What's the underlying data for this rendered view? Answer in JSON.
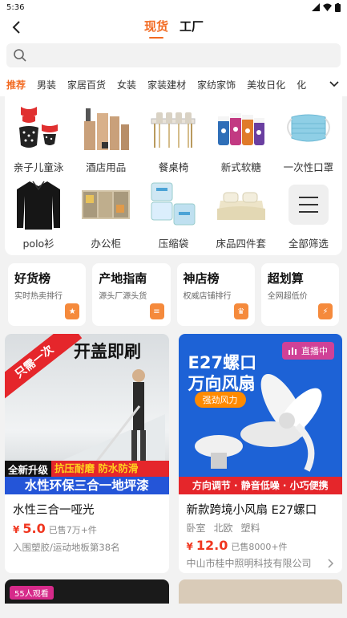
{
  "status": {
    "time": "5:36"
  },
  "nav": {
    "tabs": [
      {
        "label": "现货",
        "active": true
      },
      {
        "label": "工厂",
        "active": false
      }
    ]
  },
  "search": {
    "placeholder": ""
  },
  "categories": {
    "items": [
      "推荐",
      "男装",
      "家居百货",
      "女装",
      "家装建材",
      "家纺家饰",
      "美妆日化",
      "化"
    ],
    "active_index": 0
  },
  "grid": {
    "items": [
      {
        "label": "亲子儿童泳",
        "icon": "swimsuit-image"
      },
      {
        "label": "酒店用品",
        "icon": "hotel-supplies-image"
      },
      {
        "label": "餐桌椅",
        "icon": "dining-chairs-image"
      },
      {
        "label": "新式软糖",
        "icon": "gummy-jars-image"
      },
      {
        "label": "一次性口罩",
        "icon": "mask-image"
      },
      {
        "label": "polo衫",
        "icon": "polo-shirt-image"
      },
      {
        "label": "办公柜",
        "icon": "office-cabinet-image"
      },
      {
        "label": "压缩袋",
        "icon": "compression-bag-image"
      },
      {
        "label": "床品四件套",
        "icon": "bedding-image"
      },
      {
        "label": "全部筛选",
        "icon": "menu-icon"
      }
    ]
  },
  "rankings": [
    {
      "title": "好货榜",
      "subtitle": "实时热卖排行",
      "icon": "star-badge-icon"
    },
    {
      "title": "产地指南",
      "subtitle": "源头厂源头货",
      "icon": "list-badge-icon"
    },
    {
      "title": "神店榜",
      "subtitle": "权威店铺排行",
      "icon": "trophy-badge-icon"
    },
    {
      "title": "超划算",
      "subtitle": "全网超低价",
      "icon": "bolt-badge-icon"
    }
  ],
  "products": [
    {
      "banner_corner": "只需一次",
      "banner_top": "开盖即刷",
      "banner_line1": "全新升级",
      "banner_line1b": "抗压耐磨 防水防滑",
      "banner_line2": "水性环保三合一地坪漆",
      "title": "水性三合一哑光",
      "price_symbol": "¥",
      "price": "5.0",
      "sold": "已售7万+件",
      "extra": "入围塑胶/运动地板第38名"
    },
    {
      "banner_title1": "E27螺口",
      "banner_title2": "万向风扇",
      "banner_tag": "强劲风力",
      "banner_bottom": "方向调节 · 静音低噪 · 小巧便携",
      "live_label": "直播中",
      "title": "新款跨境小风扇 E27螺口",
      "tags": [
        "卧室",
        "北欧",
        "塑料"
      ],
      "price_symbol": "¥",
      "price": "12.0",
      "sold": "已售8000+件",
      "shop": "中山市桂中照明科技有限公司"
    }
  ],
  "peek": {
    "live_count": "55人观看"
  },
  "colors": {
    "accent": "#f26a21",
    "price": "#f0361f"
  }
}
